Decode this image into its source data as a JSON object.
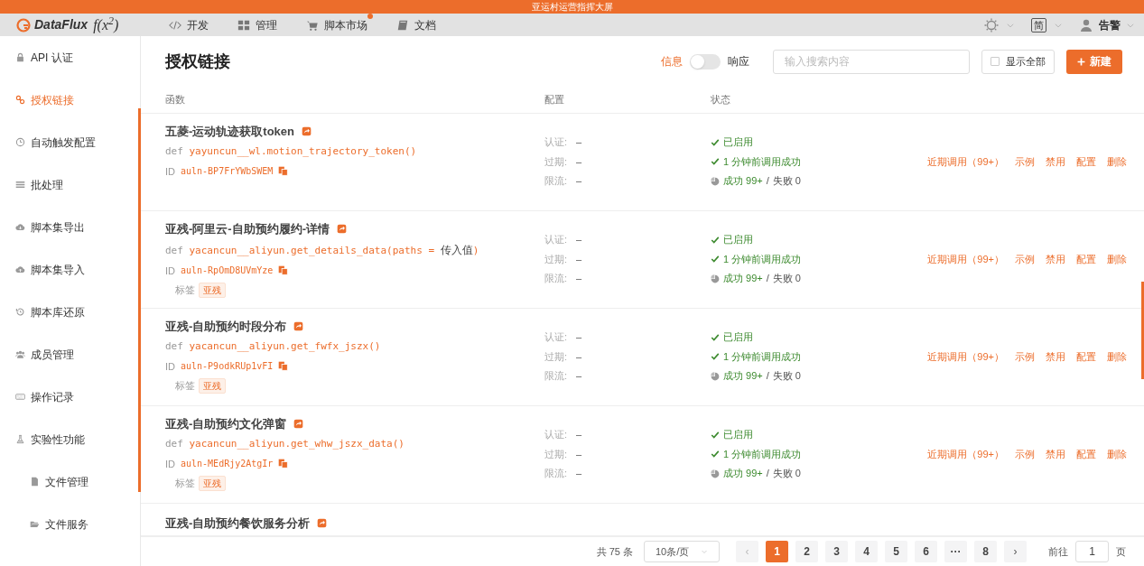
{
  "banner": {
    "title": "亚运村运营指挥大屏"
  },
  "topnav": {
    "logo": {
      "brand": "DataFlux",
      "formula": "f(x$^{2}$)"
    },
    "items": [
      {
        "label": "开发",
        "badge": false
      },
      {
        "label": "管理",
        "badge": false
      },
      {
        "label": "脚本市场",
        "badge": true
      },
      {
        "label": "文档",
        "badge": false
      }
    ],
    "language": "简",
    "user": "告警"
  },
  "sidebar": {
    "items": [
      {
        "label": "API 认证",
        "selected": false
      },
      {
        "label": "授权链接",
        "selected": true
      },
      {
        "label": "自动触发配置",
        "selected": false
      },
      {
        "label": "批处理",
        "selected": false
      },
      {
        "label": "脚本集导出",
        "selected": false
      },
      {
        "label": "脚本集导入",
        "selected": false
      },
      {
        "label": "脚本库还原",
        "selected": false
      },
      {
        "label": "成员管理",
        "selected": false
      },
      {
        "label": "操作记录",
        "selected": false
      },
      {
        "label": "实验性功能",
        "selected": false,
        "children": [
          {
            "label": "文件管理",
            "selected": false
          },
          {
            "label": "文件服务",
            "selected": false
          }
        ]
      }
    ]
  },
  "header": {
    "title": "授权链接",
    "toggle": {
      "left": "信息",
      "right": "响应",
      "on": false
    },
    "search": {
      "placeholder": "输入搜索内容"
    },
    "show_all": {
      "label": "显示全部",
      "checked": false
    },
    "new_button": "新建"
  },
  "table": {
    "columns": [
      "函数",
      "配置",
      "状态"
    ],
    "rows": [
      {
        "title": "五菱-运动轨迹获取token",
        "def": "def",
        "signature": [
          {
            "kind": "code",
            "text": "yayuncun__wl.motion_trajectory_token()"
          }
        ],
        "id_label": "ID",
        "id": "auln-BP7FrYWbSWEM",
        "config": [
          {
            "label": "认证:",
            "value": "–"
          },
          {
            "label": "过期:",
            "value": "–"
          },
          {
            "label": "限流:",
            "value": "–"
          }
        ],
        "status": {
          "enabled": "已启用",
          "last_call": "1 分钟前调用成功",
          "success": "成功 99+",
          "sep": "/",
          "fail": "失败 0"
        },
        "actions": [
          "近期调用（99+）",
          "示例",
          "禁用",
          "配置",
          "删除"
        ]
      },
      {
        "title": "亚残-阿里云-自助预约履约-详情",
        "def": "def",
        "signature": [
          {
            "kind": "code",
            "text": "yacancun__aliyun.get_details_data(paths = "
          },
          {
            "kind": "value",
            "text": "传入值"
          },
          {
            "kind": "code",
            "text": ")"
          }
        ],
        "id_label": "ID",
        "id": "auln-RpOmD8UVmYze",
        "tag_label": "标签",
        "tags": [
          "亚残"
        ],
        "config": [
          {
            "label": "认证:",
            "value": "–"
          },
          {
            "label": "过期:",
            "value": "–"
          },
          {
            "label": "限流:",
            "value": "–"
          }
        ],
        "status": {
          "enabled": "已启用",
          "last_call": "1 分钟前调用成功",
          "success": "成功 99+",
          "sep": "/",
          "fail": "失败 0"
        },
        "actions": [
          "近期调用（99+）",
          "示例",
          "禁用",
          "配置",
          "删除"
        ]
      },
      {
        "title": "亚残-自助预约时段分布",
        "def": "def",
        "signature": [
          {
            "kind": "code",
            "text": "yacancun__aliyun.get_fwfx_jszx()"
          }
        ],
        "id_label": "ID",
        "id": "auln-P9odkRUp1vFI",
        "tag_label": "标签",
        "tags": [
          "亚残"
        ],
        "config": [
          {
            "label": "认证:",
            "value": "–"
          },
          {
            "label": "过期:",
            "value": "–"
          },
          {
            "label": "限流:",
            "value": "–"
          }
        ],
        "status": {
          "enabled": "已启用",
          "last_call": "1 分钟前调用成功",
          "success": "成功 99+",
          "sep": "/",
          "fail": "失败 0"
        },
        "actions": [
          "近期调用（99+）",
          "示例",
          "禁用",
          "配置",
          "删除"
        ]
      },
      {
        "title": "亚残-自助预约文化弹窗",
        "def": "def",
        "signature": [
          {
            "kind": "code",
            "text": "yacancun__aliyun.get_whw_jszx_data()"
          }
        ],
        "id_label": "ID",
        "id": "auln-MEdRjy2AtgIr",
        "tag_label": "标签",
        "tags": [
          "亚残"
        ],
        "config": [
          {
            "label": "认证:",
            "value": "–"
          },
          {
            "label": "过期:",
            "value": "–"
          },
          {
            "label": "限流:",
            "value": "–"
          }
        ],
        "status": {
          "enabled": "已启用",
          "last_call": "1 分钟前调用成功",
          "success": "成功 99+",
          "sep": "/",
          "fail": "失败 0"
        },
        "actions": [
          "近期调用（99+）",
          "示例",
          "禁用",
          "配置",
          "删除"
        ]
      },
      {
        "title": "亚残-自助预约餐饮服务分析"
      }
    ]
  },
  "pagination": {
    "total": "共 75 条",
    "page_size": "10条/页",
    "prev": "‹",
    "pages": [
      {
        "label": "1",
        "selected": true
      },
      {
        "label": "2",
        "selected": false
      },
      {
        "label": "3",
        "selected": false
      },
      {
        "label": "4",
        "selected": false
      },
      {
        "label": "5",
        "selected": false
      },
      {
        "label": "6",
        "selected": false
      },
      {
        "label": "···",
        "selected": false
      },
      {
        "label": "8",
        "selected": false
      }
    ],
    "next": "›",
    "goto": "前往",
    "goto_value": "1",
    "page_unit": "页"
  }
}
